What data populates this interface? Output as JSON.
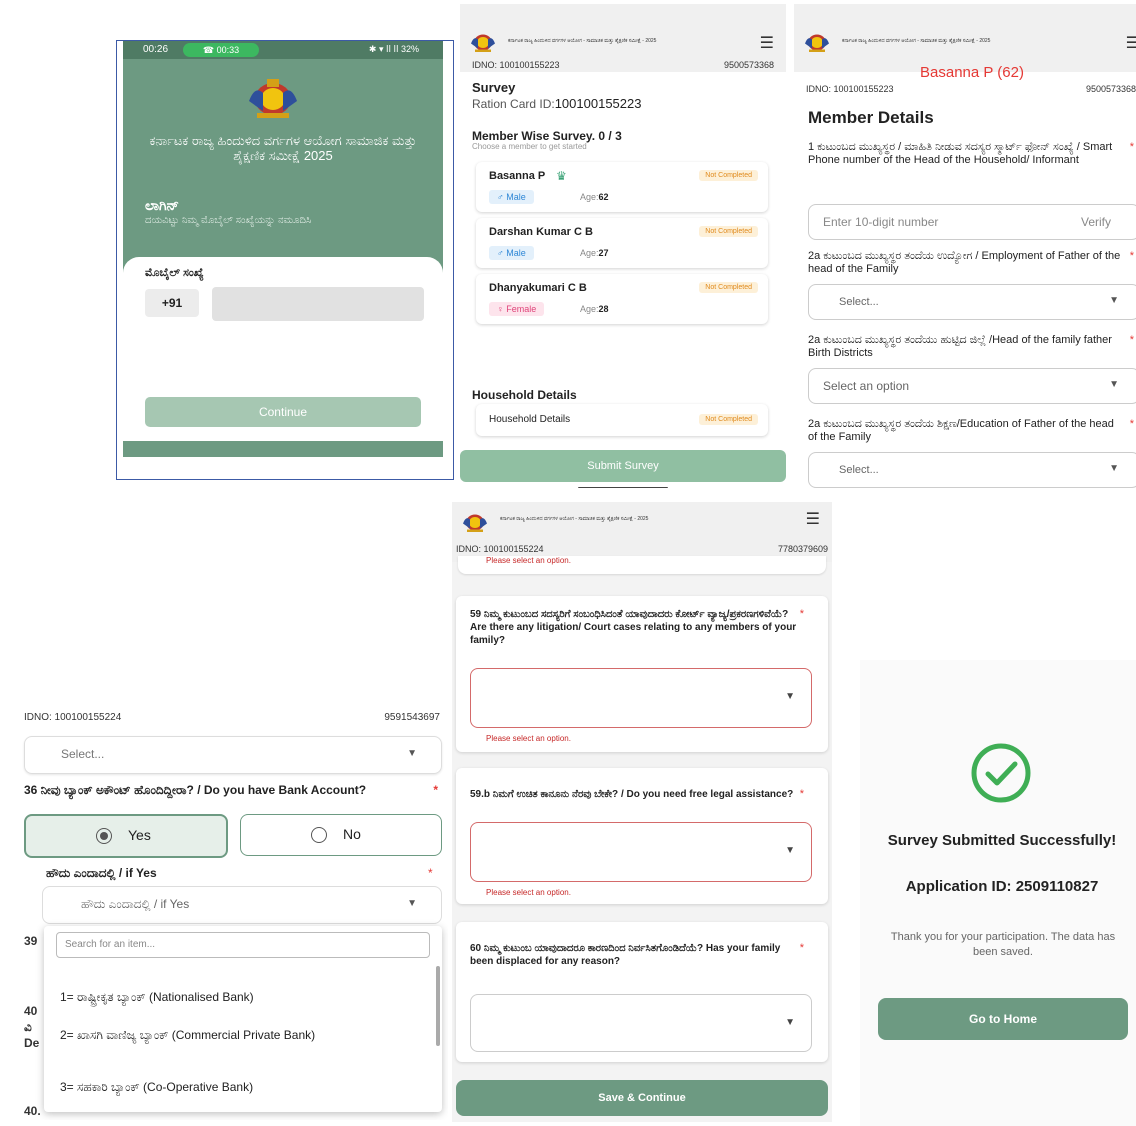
{
  "login": {
    "status_time": "00:26",
    "call_timer": "00:33",
    "status_right": "32%",
    "title": "ಕರ್ನಾಟಕ ರಾಜ್ಯ ಹಿಂದುಳಿದ ವರ್ಗಗಳ ಆಯೋಗ ಸಾಮಾಜಿಕ ಮತ್ತು ಶೈಕ್ಷಣಿಕ ಸಮೀಕ್ಷೆ 2025",
    "login_heading": "ಲಾಗಿನ್",
    "login_sub": "ದಯವಿಟ್ಟು ನಿಮ್ಮ ಮೊಬೈಲ್ ಸಂಖ್ಯೆಯನ್ನು ನಮೂದಿಸಿ",
    "mobile_label": "ಮೊಬೈಲ್ ಸಂಖ್ಯೆ",
    "country_code": "+91",
    "mobile_value": "",
    "continue_label": "Continue"
  },
  "header": {
    "title": "ಕರ್ನಾಟಕ ರಾಜ್ಯ ಹಿಂದುಳಿದ ವರ್ಗಗಳ ಆಯೋಗ - ಸಾಮಾಜಿಕ ಮತ್ತು ಶೈಕ್ಷಣಿಕ ಸಮೀಕ್ಷೆ - 2025",
    "menu_icon": "hamburger-menu-icon"
  },
  "survey": {
    "idno": "IDNO: 100100155223",
    "phone": "9500573368",
    "title": "Survey",
    "ration_label": "Ration Card ID:",
    "ration_id": "100100155223",
    "member_wise": "Member Wise Survey.  0 / 3",
    "member_sub": "Choose a member to get started",
    "members": [
      {
        "name": "Basanna P",
        "gender": "Male",
        "age_label": "Age:",
        "age": "62",
        "status": "Not Completed",
        "head": true
      },
      {
        "name": "Darshan Kumar C B",
        "gender": "Male",
        "age_label": "Age:",
        "age": "27",
        "status": "Not Completed",
        "head": false
      },
      {
        "name": "Dhanyakumari C B",
        "gender": "Female",
        "age_label": "Age:",
        "age": "28",
        "status": "Not Completed",
        "head": false
      }
    ],
    "household_title": "Household Details",
    "household_label": "Household Details",
    "household_status": "Not Completed",
    "submit_label": "Submit Survey"
  },
  "member": {
    "name_age": "Basanna P (62)",
    "idno": "IDNO: 100100155223",
    "phone": "9500573368",
    "title": "Member Details",
    "q1": "1 ಕುಟುಂಬದ ಮುಖ್ಯಸ್ಥರ / ಮಾಹಿತಿ ನೀಡುವ ಸದಸ್ಯರ ಸ್ಮಾರ್ಟ್ ಫೋನ್ ಸಂಖ್ಯೆ / Smart Phone number of the Head of the Household/ Informant",
    "q1_placeholder": "Enter 10-digit number",
    "verify_label": "Verify",
    "q2": "2a ಕುಟುಂಬದ ಮುಖ್ಯಸ್ಥರ ತಂದೆಯ ಉದ್ಯೋಗ / Employment of Father of the head of the Family",
    "q2_placeholder": "Select...",
    "q3": "2a ಕುಟುಂಬದ ಮುಖ್ಯಸ್ಥರ ತಂದೆಯು ಹುಟ್ಟಿದ ಜಿಲ್ಲೆ /Head of the family father Birth Districts",
    "q3_placeholder": "Select an option",
    "q4": "2a ಕುಟುಂಬದ ಮುಖ್ಯಸ್ಥರ ತಂದೆಯ ಶಿಕ್ಷಣ/Education of Father of the head of the Family",
    "q4_placeholder": "Select...",
    "required_mark": "*"
  },
  "bank": {
    "idno": "IDNO: 100100155224",
    "phone": "9591543697",
    "select_placeholder": "Select...",
    "q36": "36 ನೀವು ಬ್ಯಾಂಕ್ ಅಕೌಂಟ್ ಹೊಂದಿದ್ದೀರಾ? / Do you have Bank Account?",
    "yes_label": "Yes",
    "no_label": "No",
    "if_yes_label": "ಹೌದು ಎಂದಾದಲ್ಲಿ / if Yes",
    "if_yes_placeholder": "ಹೌದು ಎಂದಾದಲ್ಲಿ / if Yes",
    "search_placeholder": "Search for an item...",
    "options": [
      "1= ರಾಷ್ಟ್ರೀಕೃತ ಬ್ಯಾಂಕ್ (Nationalised Bank)",
      "2= ಖಾಸಗಿ ವಾಣಿಜ್ಯ ಬ್ಯಾಂಕ್ (Commercial Private Bank)",
      "3= ಸಹಕಾರಿ ಬ್ಯಾಂಕ್ (Co-Operative Bank)"
    ],
    "bg_39": "39",
    "bg_40": "40",
    "bg_vi": "ವಿ",
    "bg_de": "De",
    "last_40": "40.",
    "required_mark": "*"
  },
  "litigation": {
    "idno": "IDNO: 100100155224",
    "phone": "7780379609",
    "top_error": "Please select an option.",
    "q59": "59 ನಿಮ್ಮ ಕುಟುಂಬದ ಸದಸ್ಯರಿಗೆ ಸಂಬಂಧಿಸಿದಂತೆ ಯಾವುದಾದರು ಕೋರ್ಟ್ ವ್ಯಾಜ್ಯ/ಪ್ರಕರಣಗಳಿವೆಯೆ? Are there any litigation/ Court cases relating to any members of your family?",
    "q59_error": "Please select an option.",
    "q59b": "59.b ನಿಮಗೆ ಉಚಿತ ಕಾನೂನು ನೆರವು ಬೇಕೇ? / Do you need free legal assistance?",
    "q59b_error": "Please select an option.",
    "q60": "60 ನಿಮ್ಮ ಕುಟುಂಬ ಯಾವುದಾದರೂ ಕಾರಣದಿಂದ ನಿರ್ವಸಿತಗೊಂಡಿದೆಯೆ? Has your family been displaced for any reason?",
    "save_label": "Save & Continue",
    "required_mark": "*"
  },
  "success": {
    "top_mark": "-",
    "message": "Survey Submitted Successfully!",
    "app_id": "Application ID: 2509110827",
    "thanks": "Thank you for your participation. The data has been saved.",
    "home_label": "Go to Home"
  }
}
